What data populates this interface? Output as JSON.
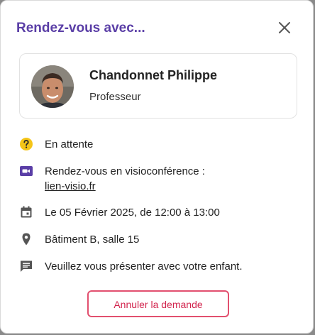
{
  "dialog": {
    "title": "Rendez-vous avec...",
    "close_icon": "close-icon"
  },
  "person": {
    "name": "Chandonnet Philippe",
    "role": "Professeur"
  },
  "details": {
    "status": "En attente",
    "visio_label": "Rendez-vous en visioconférence :",
    "visio_link": "lien-visio.fr",
    "date": "Le 05 Février 2025, de 12:00 à 13:00",
    "location": "Bâtiment B, salle 15",
    "message": "Veuillez vous présenter avec votre enfant."
  },
  "actions": {
    "cancel_label": "Annuler la demande"
  },
  "colors": {
    "accent": "#5a3ea6",
    "status": "#f5c518",
    "danger": "#d2254e",
    "icon": "#555555"
  }
}
